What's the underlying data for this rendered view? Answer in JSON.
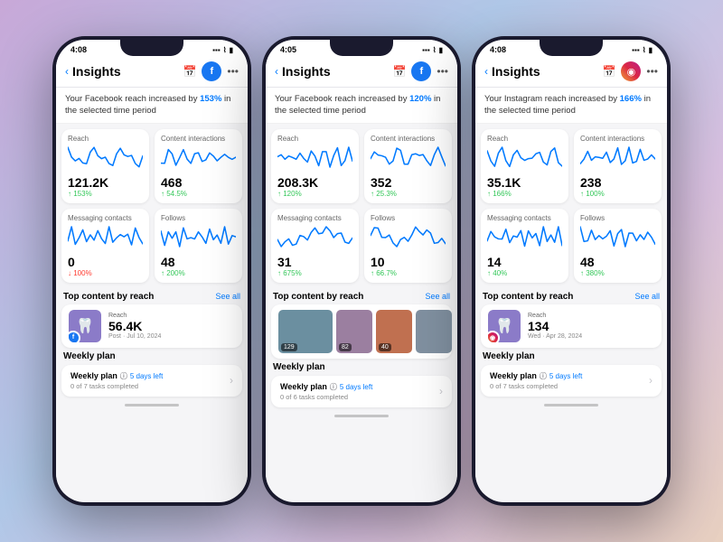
{
  "phones": [
    {
      "id": "phone1",
      "statusTime": "4:08",
      "platform": "facebook",
      "platformIcon": "f",
      "platformBg": "#1877F2",
      "header": {
        "title": "Insights",
        "backLabel": "‹"
      },
      "banner": {
        "text": "Your Facebook reach increased by ",
        "highlight": "153%",
        "suffix": " in the selected time period"
      },
      "metrics": [
        {
          "label": "Reach",
          "value": "121.2K",
          "change": "↑ 153%",
          "changeType": "up",
          "sparkColor": "#007AFF"
        },
        {
          "label": "Content interactions",
          "value": "468",
          "change": "↑ 54.5%",
          "changeType": "up",
          "sparkColor": "#007AFF"
        },
        {
          "label": "Messaging contacts",
          "value": "0",
          "change": "↓ 100%",
          "changeType": "down",
          "sparkColor": "#007AFF"
        },
        {
          "label": "Follows",
          "value": "48",
          "change": "↑ 200%",
          "changeType": "up",
          "sparkColor": "#007AFF"
        }
      ],
      "topContent": {
        "title": "Top content by reach",
        "seeAll": "See all",
        "type": "single",
        "reachLabel": "Reach",
        "reachValue": "56.4K",
        "meta": "Post · Jul 10, 2024",
        "thumbColor": "#8B7BC8",
        "avatarPlatform": "fb"
      },
      "weeklyPlan": {
        "title": "Weekly plan",
        "planName": "Weekly plan",
        "daysLeft": "5 days left",
        "progress": "0 of 7 tasks completed"
      }
    },
    {
      "id": "phone2",
      "statusTime": "4:05",
      "platform": "facebook",
      "platformIcon": "f",
      "platformBg": "#1877F2",
      "header": {
        "title": "Insights",
        "backLabel": "‹"
      },
      "banner": {
        "text": "Your Facebook reach increased by ",
        "highlight": "120%",
        "suffix": " in the selected time period"
      },
      "metrics": [
        {
          "label": "Reach",
          "value": "208.3K",
          "change": "↑ 120%",
          "changeType": "up",
          "sparkColor": "#007AFF"
        },
        {
          "label": "Content interactions",
          "value": "352",
          "change": "↑ 25.3%",
          "changeType": "up",
          "sparkColor": "#007AFF"
        },
        {
          "label": "Messaging contacts",
          "value": "31",
          "change": "↑ 675%",
          "changeType": "up",
          "sparkColor": "#007AFF"
        },
        {
          "label": "Follows",
          "value": "10",
          "change": "↑ 66.7%",
          "changeType": "up",
          "sparkColor": "#007AFF"
        }
      ],
      "topContent": {
        "title": "Top content by reach",
        "seeAll": "See all",
        "type": "multi",
        "images": [
          {
            "count": "129",
            "bg": "#6B8FA0"
          },
          {
            "count": "82",
            "bg": "#9B7FA0"
          },
          {
            "count": "40",
            "bg": "#C07050"
          },
          {
            "count": "",
            "bg": "#8090A0"
          }
        ]
      },
      "weeklyPlan": {
        "title": "Weekly plan",
        "planName": "Weekly plan",
        "daysLeft": "5 days left",
        "progress": "0 of 6 tasks completed"
      }
    },
    {
      "id": "phone3",
      "statusTime": "4:08",
      "platform": "instagram",
      "platformIcon": "◉",
      "platformBg": "instagram",
      "header": {
        "title": "Insights",
        "backLabel": "‹"
      },
      "banner": {
        "text": "Your Instagram reach increased by ",
        "highlight": "166%",
        "suffix": " in the selected time period"
      },
      "metrics": [
        {
          "label": "Reach",
          "value": "35.1K",
          "change": "↑ 166%",
          "changeType": "up",
          "sparkColor": "#007AFF"
        },
        {
          "label": "Content interactions",
          "value": "238",
          "change": "↑ 100%",
          "changeType": "up",
          "sparkColor": "#007AFF"
        },
        {
          "label": "Messaging contacts",
          "value": "14",
          "change": "↑ 40%",
          "changeType": "up",
          "sparkColor": "#007AFF"
        },
        {
          "label": "Follows",
          "value": "48",
          "change": "↑ 380%",
          "changeType": "up",
          "sparkColor": "#007AFF"
        }
      ],
      "topContent": {
        "title": "Top content by reach",
        "seeAll": "See all",
        "type": "single",
        "reachLabel": "Reach",
        "reachValue": "134",
        "meta": "Wed · Apr 28, 2024",
        "thumbColor": "#8B7BC8",
        "avatarPlatform": "ig"
      },
      "weeklyPlan": {
        "title": "Weekly plan",
        "planName": "Weekly plan",
        "daysLeft": "5 days left",
        "progress": "0 of 7 tasks completed"
      }
    }
  ]
}
